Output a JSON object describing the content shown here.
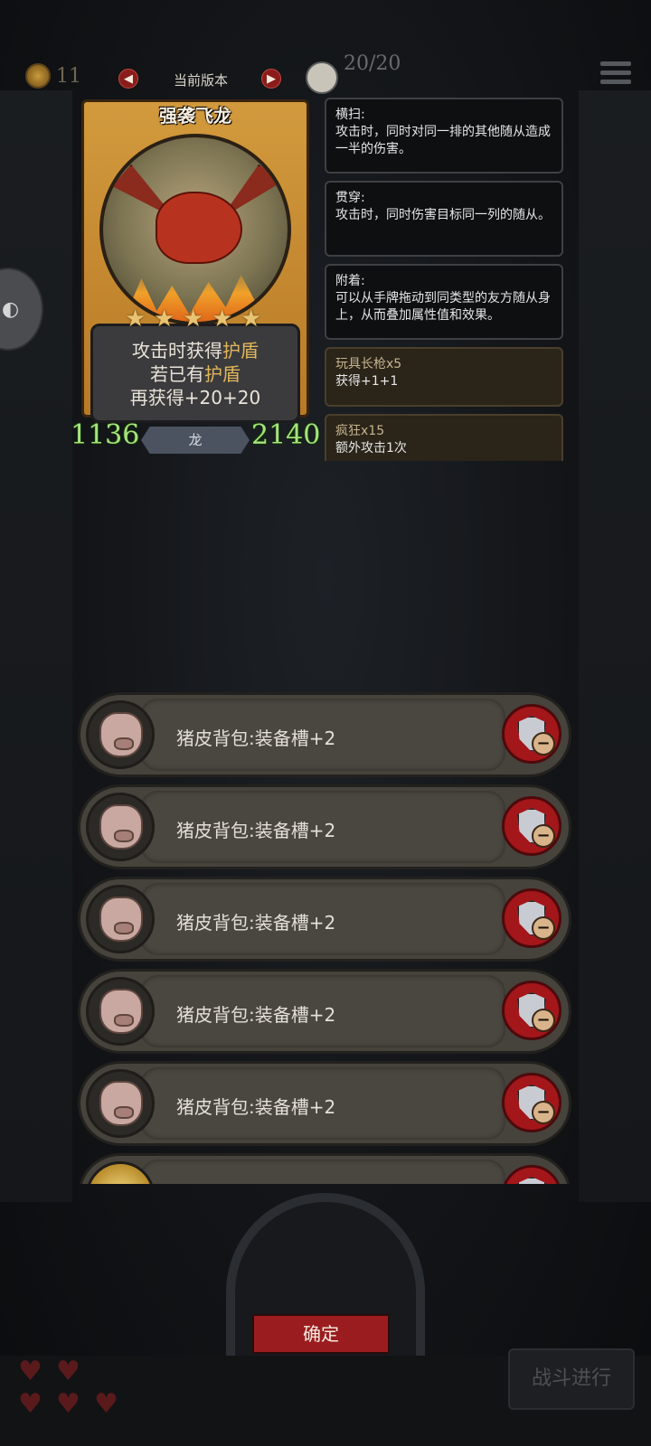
{
  "top_bar": {
    "coins": "11",
    "version_label": "当前版本",
    "prev_icon": "chevron-left-icon",
    "next_icon": "chevron-right-icon",
    "slots": "20/20"
  },
  "card": {
    "name": "强袭飞龙",
    "stars": 5,
    "desc_line1_prefix": "攻击时获得",
    "desc_line1_keyword": "护盾",
    "desc_line2_prefix": "若已有",
    "desc_line2_keyword": "护盾",
    "desc_line3": "再获得+20+20",
    "tribe": "龙",
    "attack": "1136",
    "health": "2140"
  },
  "keywords": [
    {
      "title": "横扫:",
      "text": "攻击时，同时对同一排的其他随从造成一半的伤害。"
    },
    {
      "title": "贯穿:",
      "text": "攻击时，同时伤害目标同一列的随从。"
    },
    {
      "title": "附着:",
      "text": "可以从手牌拖动到同类型的友方随从身上，从而叠加属性值和效果。"
    },
    {
      "title": "玩具长枪x5",
      "text": "获得+1+1"
    },
    {
      "title": "疯狂x15",
      "text": "额外攻击1次"
    }
  ],
  "equipment": [
    {
      "name": "猪皮背包:装备槽+2"
    },
    {
      "name": "猪皮背包:装备槽+2"
    },
    {
      "name": "猪皮背包:装备槽+2"
    },
    {
      "name": "猪皮背包:装备槽+2"
    },
    {
      "name": "猪皮背包:装备槽+2"
    }
  ],
  "bottom": {
    "confirm_label": "确定",
    "battle_label": "战斗进行"
  },
  "colors": {
    "accent_red": "#9b1c1f",
    "keyword_gold": "#e1b65a",
    "stat_green": "#a6e37e"
  }
}
